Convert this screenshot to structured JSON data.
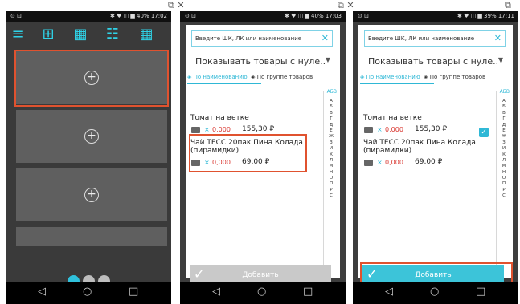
{
  "window_controls": {
    "restore": "⧉",
    "close": "✕"
  },
  "status": {
    "p1": {
      "left": "⊙ ⊡",
      "right": "✱ ♥ ◫ ▆ 40% 17:02"
    },
    "p2": {
      "left": "⊙ ⊡",
      "right": "✱ ♥ ◫ ▆ 40% 17:03"
    },
    "p3": {
      "left": "⊙ ⊡",
      "right": "✱ ♥ ◫ ▆ 39% 17:11"
    }
  },
  "navbar": {
    "back": "◁",
    "home": "○",
    "recent": "□"
  },
  "phone1": {
    "toolbar_icons": [
      "≡",
      "⊞",
      "▦",
      "☷",
      "▦"
    ],
    "tile_plus": "+",
    "pager_dots": 3,
    "active_dot": 0
  },
  "dialog": {
    "search_placeholder": "Введите ШК, ЛК или наименование",
    "search_clear": "✕",
    "filter_value": "Показывать товары с нуле..",
    "filter_arrow": "▼",
    "tab_by_name": "По наименованию",
    "tab_by_group": "По группе товаров",
    "alphabet_header": "АБВ",
    "alphabet": [
      "А",
      "Б",
      "В",
      "Г",
      "Д",
      "Е",
      "Ж",
      "З",
      "И",
      "К",
      "Л",
      "М",
      "Н",
      "О",
      "П",
      "Р",
      "С"
    ],
    "items": [
      {
        "name": "Томат на ветке",
        "x": "×",
        "qty": "0,000",
        "price": "155,30 ₽"
      },
      {
        "name": "Чай TECC 20пак Пина Колада (пирамидки)",
        "x": "×",
        "qty": "0,000",
        "price": "69,00 ₽"
      }
    ],
    "add_label": "Добавить",
    "add_check": "✓"
  },
  "colors": {
    "accent": "#2fb8d6",
    "add_disabled": "#c9c9c9",
    "add_enabled": "#3cc4d9",
    "highlight": "#e0522f",
    "qty_red": "#d9352e"
  }
}
